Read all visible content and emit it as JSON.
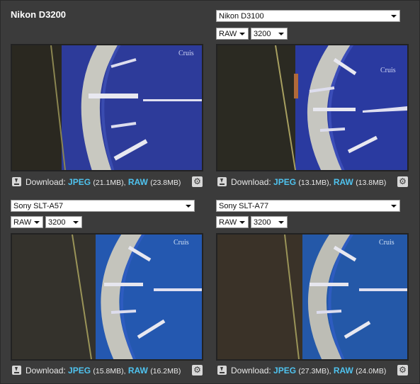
{
  "panels": [
    {
      "title": "Nikon D3200",
      "download": {
        "label": "Download:",
        "jpeg_label": "JPEG",
        "jpeg_size": "(21.1MB),",
        "raw_label": "RAW",
        "raw_size": "(23.8MB)"
      }
    },
    {
      "camera": "Nikon D3100",
      "format": "RAW",
      "iso": "3200",
      "download": {
        "label": "Download:",
        "jpeg_label": "JPEG",
        "jpeg_size": "(13.1MB),",
        "raw_label": "RAW",
        "raw_size": "(13.8MB)"
      }
    },
    {
      "camera": "Sony SLT-A57",
      "format": "RAW",
      "iso": "3200",
      "download": {
        "label": "Download:",
        "jpeg_label": "JPEG",
        "jpeg_size": "(15.8MB),",
        "raw_label": "RAW",
        "raw_size": "(16.2MB)"
      }
    },
    {
      "camera": "Sony SLT-A77",
      "format": "RAW",
      "iso": "3200",
      "download": {
        "label": "Download:",
        "jpeg_label": "JPEG",
        "jpeg_size": "(27.3MB),",
        "raw_label": "RAW",
        "raw_size": "(24.0MB)"
      }
    }
  ],
  "icons": {
    "download": "download-icon",
    "settings": "gear-icon"
  },
  "colors": {
    "link": "#4fc3ef",
    "background": "#3b3b3b"
  }
}
